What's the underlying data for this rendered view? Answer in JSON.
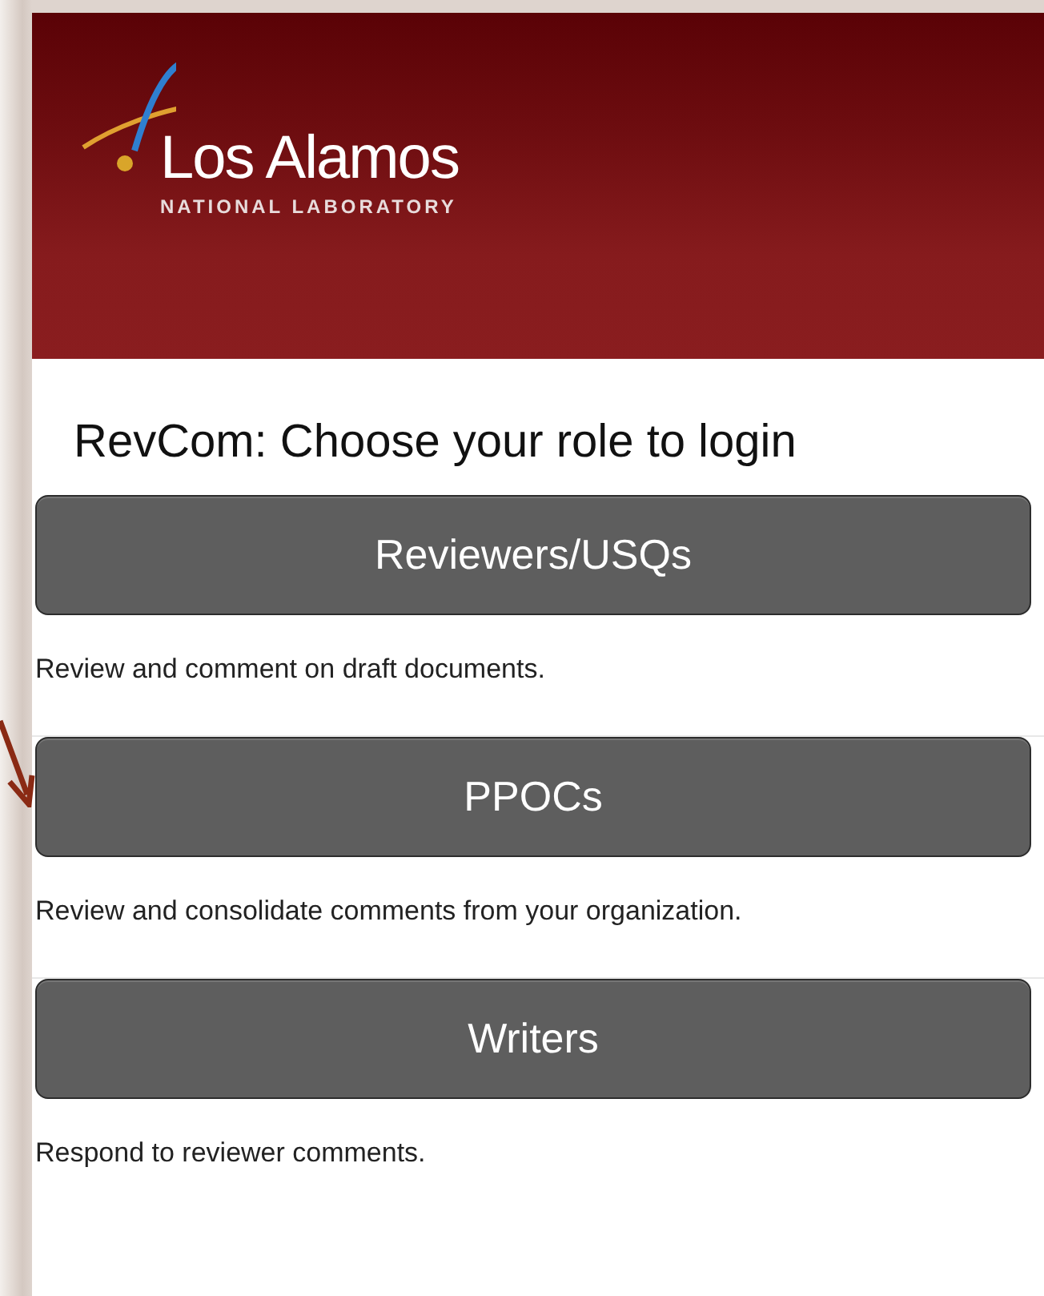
{
  "logo": {
    "name": "Los Alamos",
    "subtitle": "NATIONAL LABORATORY"
  },
  "title": "RevCom: Choose your role to login",
  "roles": [
    {
      "label": "Reviewers/USQs",
      "description": "Review and comment on draft documents."
    },
    {
      "label": "PPOCs",
      "description": "Review and consolidate comments from your organization."
    },
    {
      "label": "Writers",
      "description": "Respond to reviewer comments."
    }
  ]
}
